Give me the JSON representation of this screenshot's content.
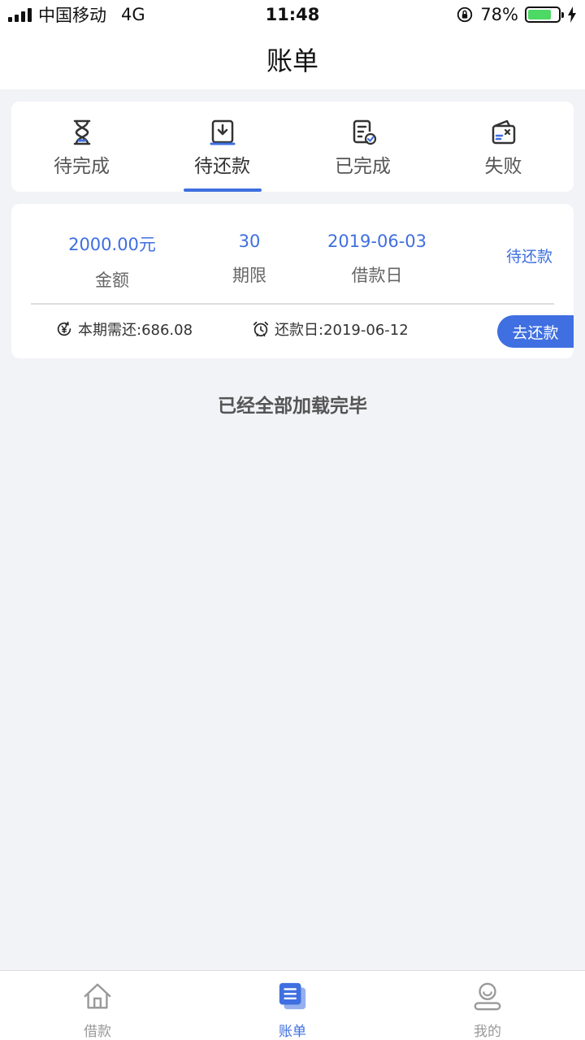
{
  "status_bar": {
    "carrier": "中国移动",
    "network": "4G",
    "time": "11:48",
    "battery": "78%",
    "battery_level": 0.78
  },
  "header": {
    "title": "账单"
  },
  "tabs": [
    {
      "label": "待完成",
      "icon": "hourglass-icon"
    },
    {
      "label": "待还款",
      "icon": "download-tray-icon",
      "active": true
    },
    {
      "label": "已完成",
      "icon": "document-check-icon"
    },
    {
      "label": "失败",
      "icon": "wallet-x-icon"
    }
  ],
  "bill": {
    "amount": "2000.00元",
    "amount_label": "金额",
    "term": "30",
    "term_label": "期限",
    "loan_date": "2019-06-03",
    "loan_date_label": "借款日",
    "status": "待还款",
    "due_amount": "本期需还:686.08",
    "due_date": "还款日:2019-06-12",
    "repay_label": "去还款"
  },
  "loaded_text": "已经全部加载完毕",
  "bottom_nav": [
    {
      "label": "借款",
      "icon": "home-icon"
    },
    {
      "label": "账单",
      "icon": "bill-list-icon",
      "active": true
    },
    {
      "label": "我的",
      "icon": "profile-icon"
    }
  ],
  "colors": {
    "accent": "#3f6fe0",
    "battery": "#4cd964"
  }
}
